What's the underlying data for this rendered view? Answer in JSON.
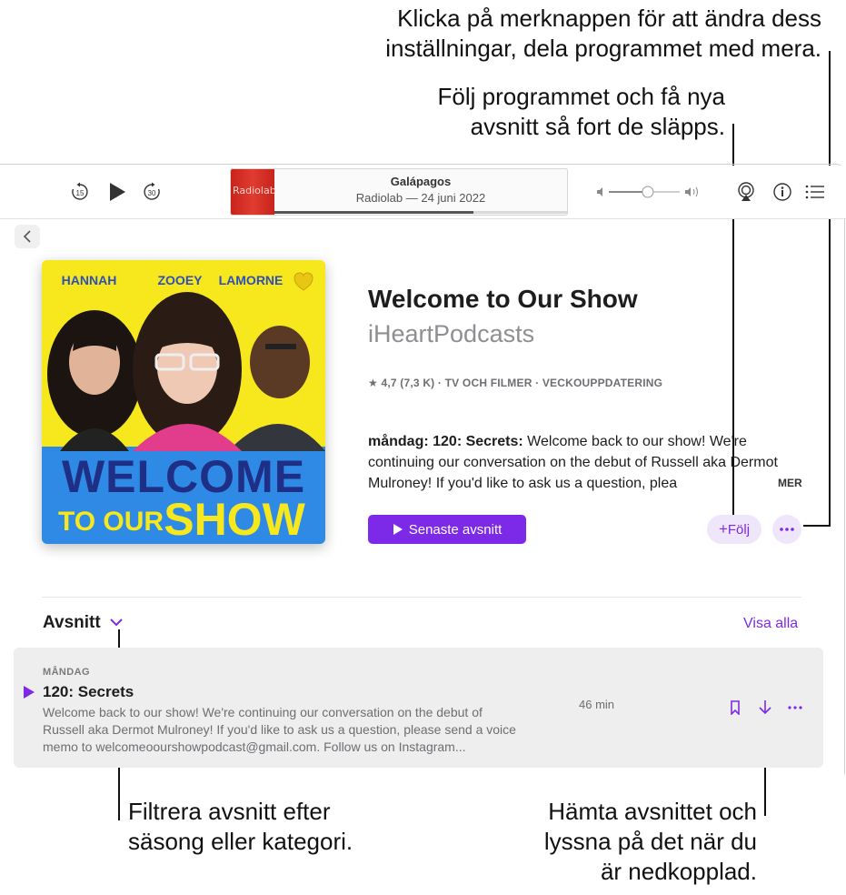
{
  "callouts": {
    "more_button": [
      "Klicka på merknappen för att ändra dess",
      "inställningar, dela programmet med mera."
    ],
    "follow": [
      "Följ programmet och få nya",
      "avsnitt så fort de släpps."
    ],
    "filter": [
      "Filtrera avsnitt efter",
      "säsong eller kategori."
    ],
    "download": [
      "Hämta avsnittet och",
      "lyssna på det när du",
      "är nedkopplad."
    ]
  },
  "player": {
    "skip_back_seconds": "15",
    "skip_forward_seconds": "30",
    "now_playing_title": "Galápagos",
    "now_playing_subtitle": "Radiolab — 24 juni 2022",
    "artwork_label": "Radiolab",
    "progress": 0.68,
    "volume": 0.55
  },
  "show": {
    "title": "Welcome to Our Show",
    "author": "iHeartPodcasts",
    "meta": "★ 4,7 (7,3 K) · TV OCH FILMER · VECKOUPPDATERING",
    "description_lead": "måndag: 120: Secrets:",
    "description_body": " Welcome back to our show! We're continuing our conversation on the debut of Russell aka Dermot Mulroney! If you'd like to ask us a question, plea",
    "more_label": "MER",
    "latest_button": "Senaste avsnitt",
    "follow_button": "Följ"
  },
  "cover": {
    "hosts": [
      "HANNAH",
      "ZOOEY",
      "LAMORNE"
    ],
    "line1": "WELCOME",
    "line2a": "TO OUR",
    "line2b": "SHOW"
  },
  "episodes": {
    "title": "Avsnitt",
    "show_all": "Visa alla",
    "items": [
      {
        "day": "MÅNDAG",
        "title": "120: Secrets",
        "description": "Welcome back to our show! We're continuing our conversation on the debut of Russell aka Dermot Mulroney! If you'd like to ask us a question, please send a voice memo to welcomeoourshowpodcast@gmail.com. Follow us on Instagram...",
        "duration": "46 min"
      }
    ]
  },
  "colors": {
    "accent": "#7d2ae8",
    "accent_light": "#efe6fb",
    "cover_yellow": "#f6e81c",
    "cover_blue": "#2f8ae6"
  }
}
